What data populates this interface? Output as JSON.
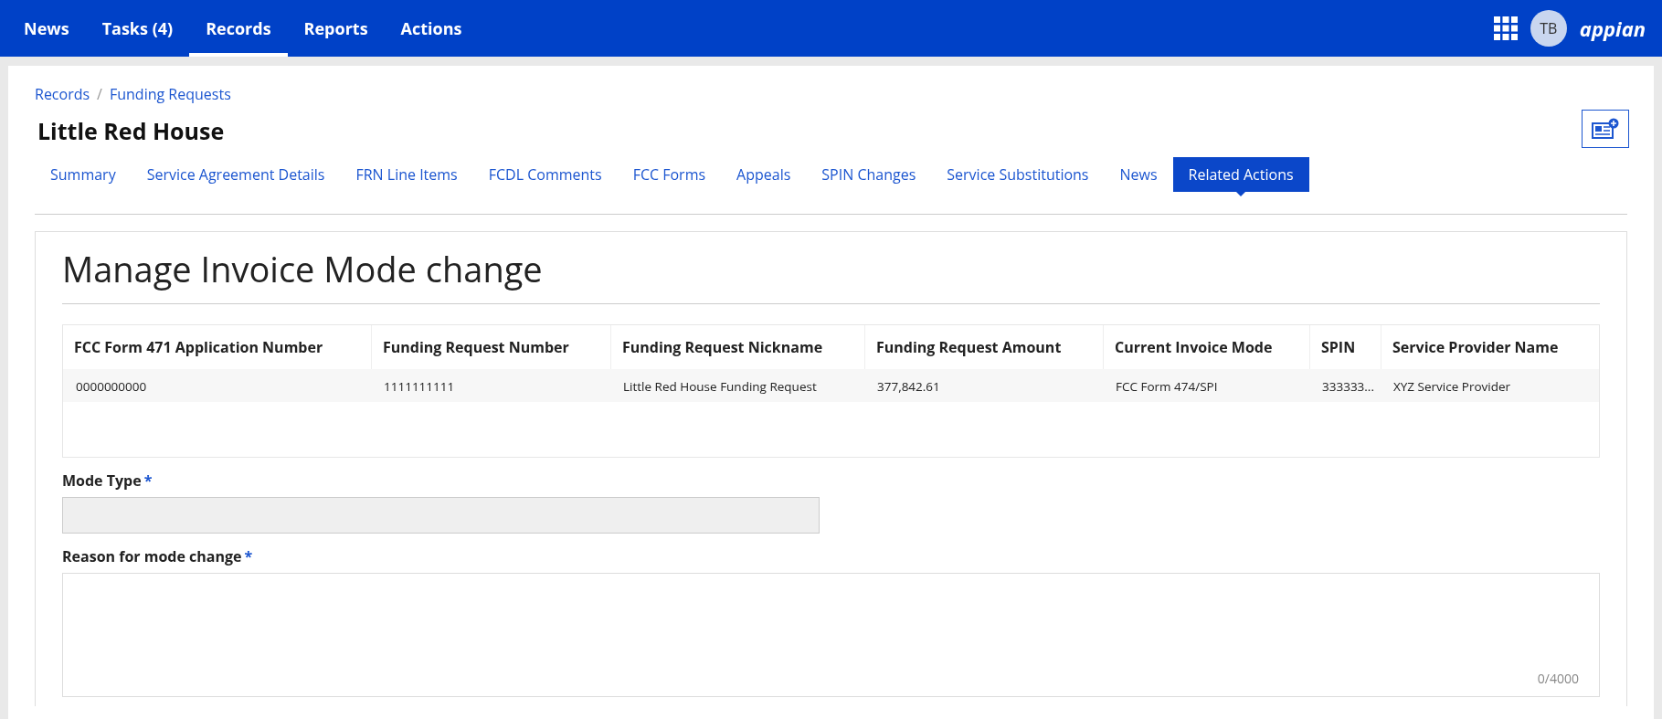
{
  "top_nav": {
    "items": [
      {
        "label": "News",
        "selected": false
      },
      {
        "label": "Tasks (4)",
        "selected": false
      },
      {
        "label": "Records",
        "selected": true
      },
      {
        "label": "Reports",
        "selected": false
      },
      {
        "label": "Actions",
        "selected": false
      }
    ],
    "avatar": "TB",
    "logo": "appian"
  },
  "breadcrumbs": [
    "Records",
    "Funding Requests"
  ],
  "breadcrumb_separator": "/",
  "record_title": "Little Red House",
  "record_tabs": [
    {
      "label": "Summary",
      "selected": false
    },
    {
      "label": "Service Agreement Details",
      "selected": false
    },
    {
      "label": "FRN Line Items",
      "selected": false
    },
    {
      "label": "FCDL Comments",
      "selected": false
    },
    {
      "label": "FCC Forms",
      "selected": false
    },
    {
      "label": "Appeals",
      "selected": false
    },
    {
      "label": "SPIN Changes",
      "selected": false
    },
    {
      "label": "Service Substitutions",
      "selected": false
    },
    {
      "label": "News",
      "selected": false
    },
    {
      "label": "Related Actions",
      "selected": true
    }
  ],
  "form": {
    "heading": "Manage Invoice Mode change",
    "table": {
      "columns": [
        "FCC Form 471 Application Number",
        "Funding Request Number",
        "Funding Request Nickname",
        "Funding Request Amount",
        "Current Invoice Mode",
        "SPIN",
        "Service Provider Name"
      ],
      "rows": [
        [
          "0000000000",
          "1111111111",
          "Little Red House Funding Request",
          "377,842.61",
          "FCC Form 474/SPI",
          "333333...",
          "XYZ Service Provider"
        ]
      ]
    },
    "fields": [
      {
        "kind": "select",
        "label": "Mode Type",
        "required_mark": "*"
      },
      {
        "kind": "textarea",
        "label": "Reason for mode change",
        "required_mark": "*",
        "counter": "0/4000"
      }
    ]
  }
}
